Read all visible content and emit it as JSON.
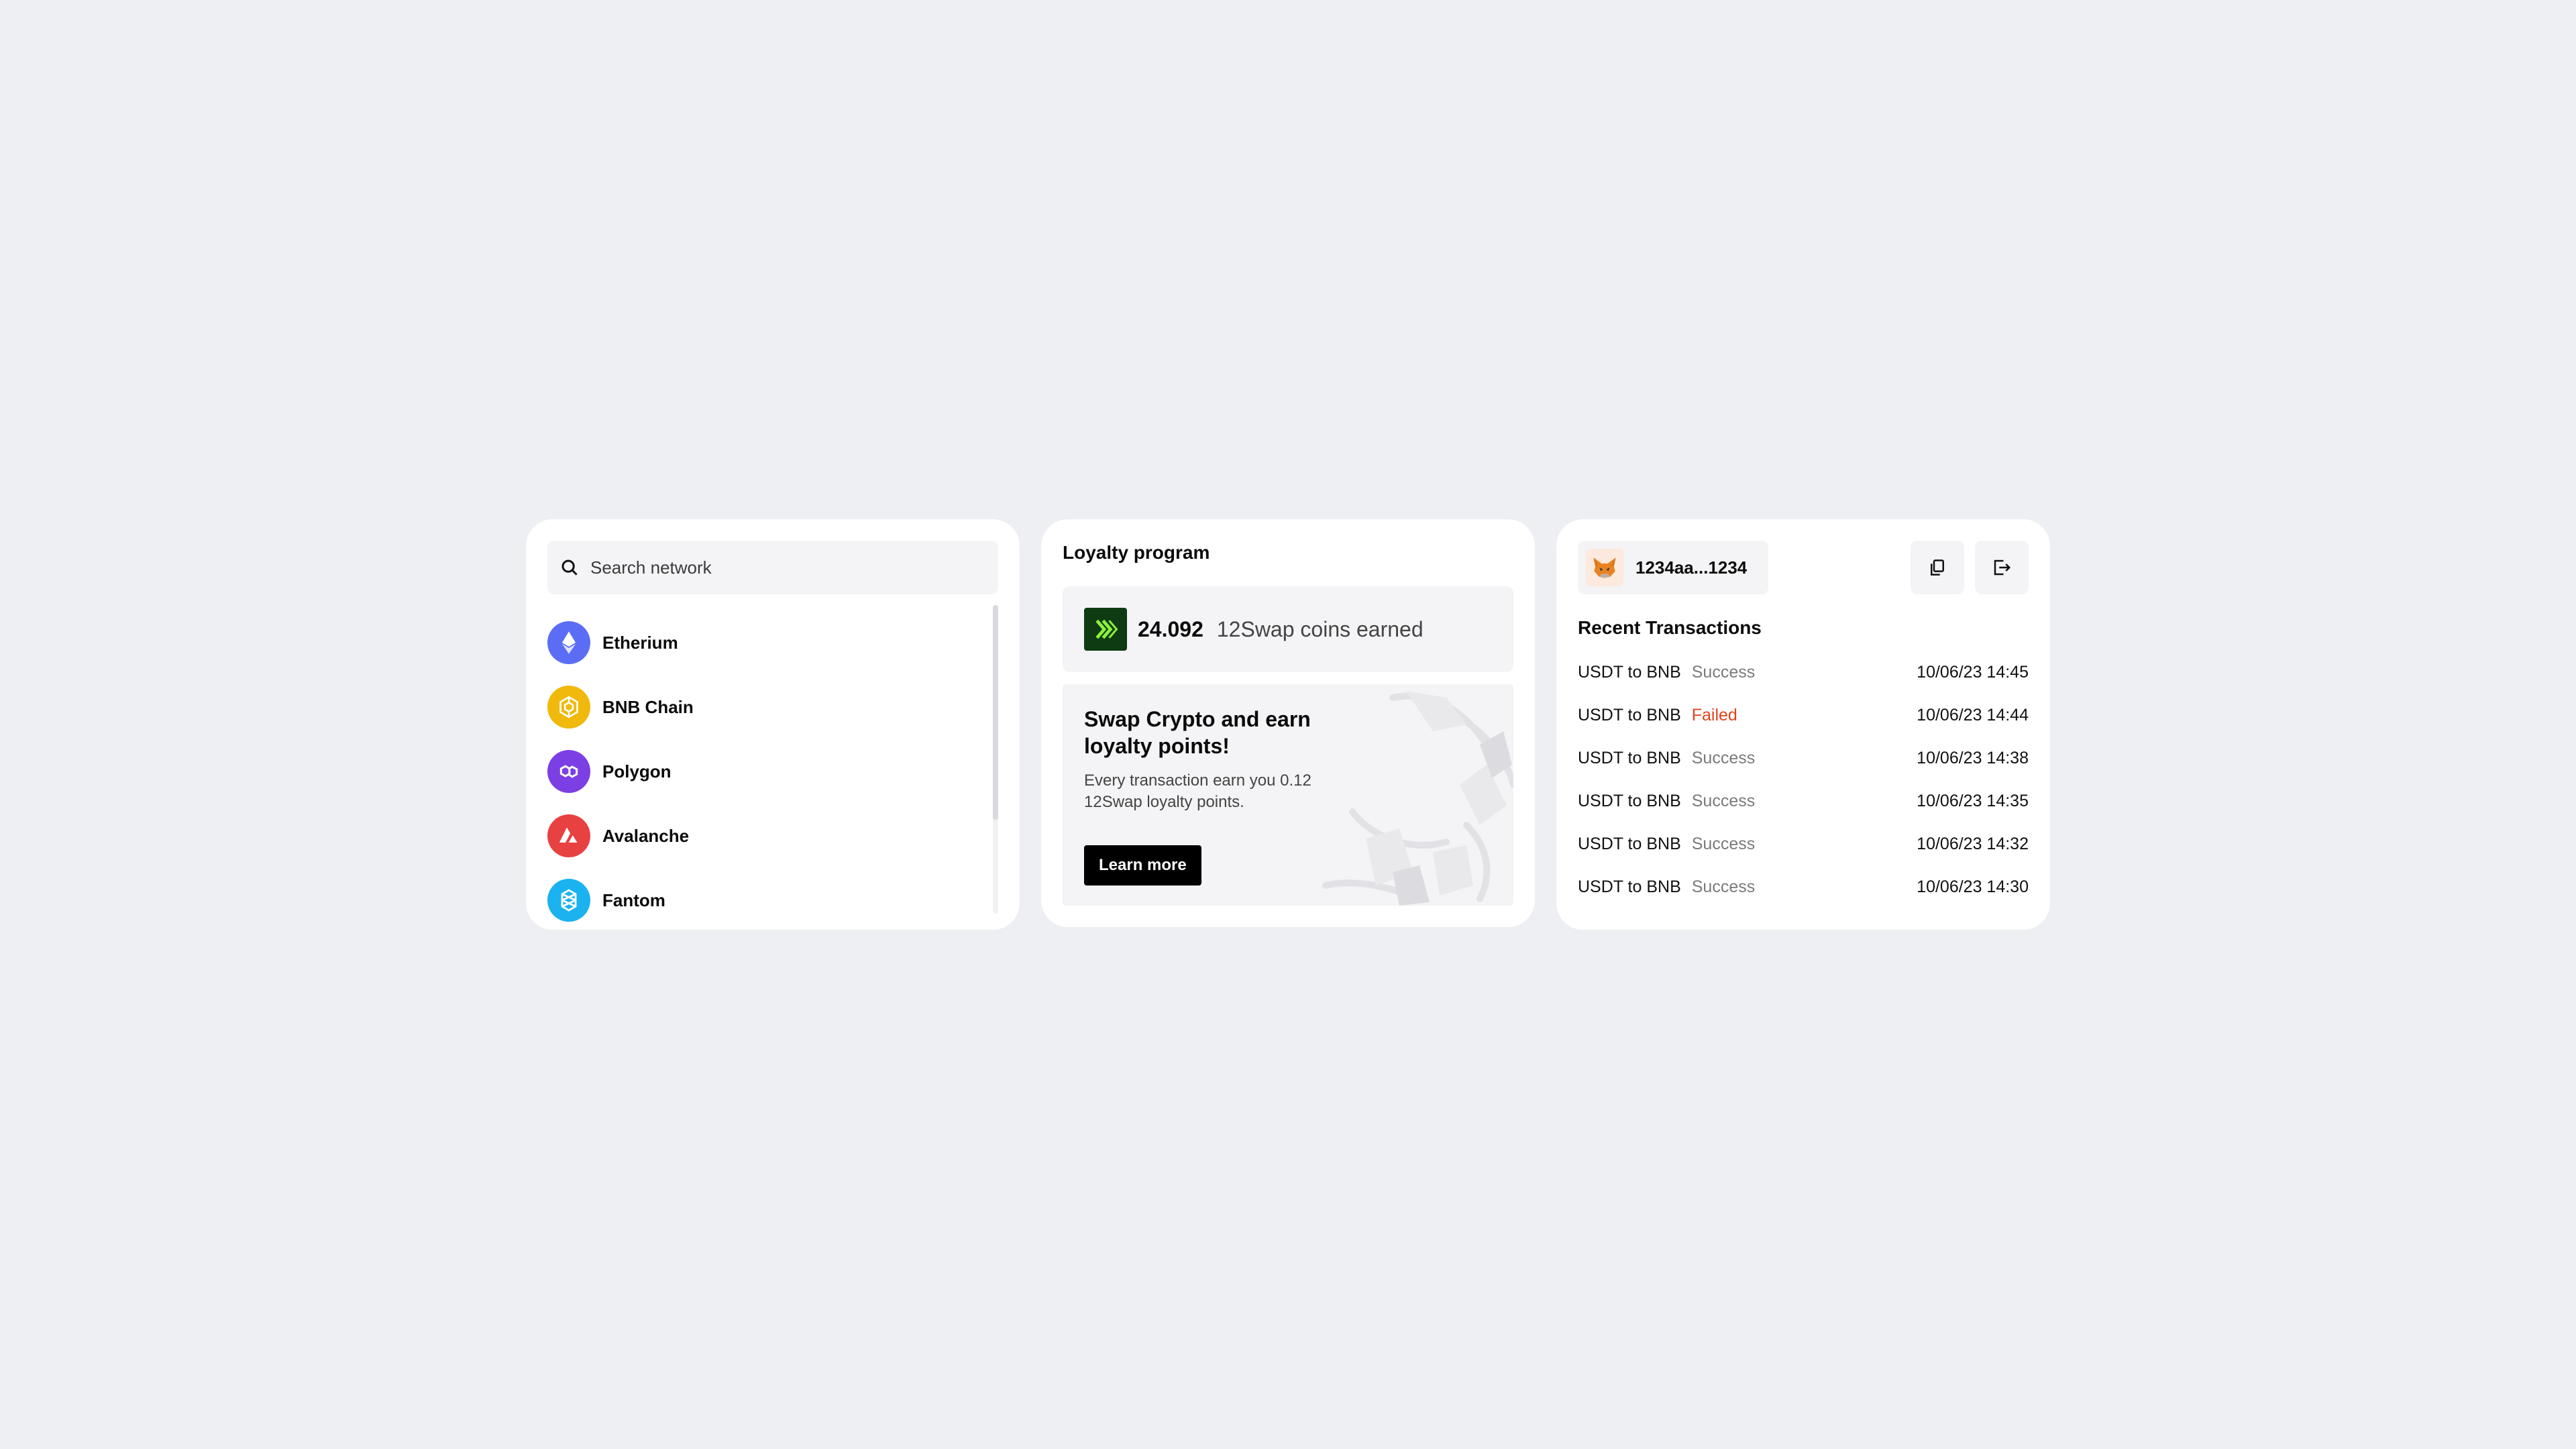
{
  "networks": {
    "search_placeholder": "Search network",
    "items": [
      {
        "label": "Etherium",
        "icon": "ethereum-icon",
        "color": "#5c6df5"
      },
      {
        "label": "BNB Chain",
        "icon": "bnb-icon",
        "color": "#f0b90b"
      },
      {
        "label": "Polygon",
        "icon": "polygon-icon",
        "color": "#7b3fe4"
      },
      {
        "label": "Avalanche",
        "icon": "avalanche-icon",
        "color": "#e84142"
      },
      {
        "label": "Fantom",
        "icon": "fantom-icon",
        "color": "#1bb2f0"
      }
    ]
  },
  "loyalty": {
    "title": "Loyalty program",
    "earned_value": "24.092",
    "earned_label": "12Swap coins earned",
    "promo_title": "Swap Crypto and earn loyalty points!",
    "promo_text": "Every transaction earn you 0.12 12Swap loyalty points.",
    "learn_more": "Learn more",
    "brand_color": "#0e3b12",
    "accent_color": "#8cf23a"
  },
  "wallet": {
    "address": "1234aa...1234",
    "icon": "metamask-fox-icon",
    "transactions_title": "Recent Transactions",
    "transactions": [
      {
        "pair": "USDT to BNB",
        "status": "Success",
        "time": "10/06/23 14:45"
      },
      {
        "pair": "USDT to BNB",
        "status": "Failed",
        "time": "10/06/23 14:44"
      },
      {
        "pair": "USDT to BNB",
        "status": "Success",
        "time": "10/06/23 14:38"
      },
      {
        "pair": "USDT to BNB",
        "status": "Success",
        "time": "10/06/23 14:35"
      },
      {
        "pair": "USDT to BNB",
        "status": "Success",
        "time": "10/06/23 14:32"
      },
      {
        "pair": "USDT to BNB",
        "status": "Success",
        "time": "10/06/23 14:30"
      }
    ],
    "status_colors": {
      "Success": "#7a7a7a",
      "Failed": "#e0431b"
    }
  }
}
